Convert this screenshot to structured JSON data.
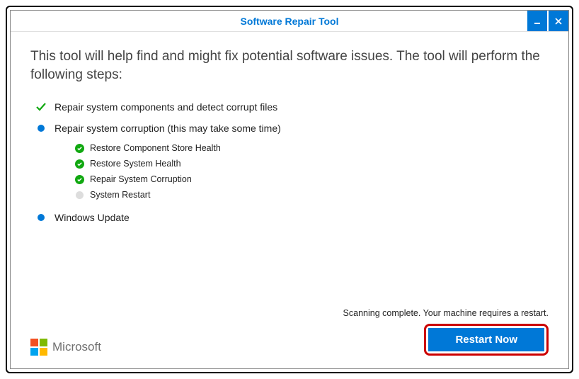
{
  "window": {
    "title": "Software Repair Tool"
  },
  "intro": "This tool will help find and might fix potential software issues. The tool will perform the following steps:",
  "steps": [
    {
      "status": "done",
      "label": "Repair system components and detect corrupt files"
    },
    {
      "status": "current",
      "label": "Repair system corruption (this may take some time)",
      "substeps": [
        {
          "status": "done",
          "label": "Restore Component Store Health"
        },
        {
          "status": "done",
          "label": "Restore System Health"
        },
        {
          "status": "done",
          "label": "Repair System Corruption"
        },
        {
          "status": "pending",
          "label": "System Restart"
        }
      ]
    },
    {
      "status": "pending_top",
      "label": "Windows Update"
    }
  ],
  "footer": {
    "brand": "Microsoft",
    "status": "Scanning complete. Your machine requires a restart.",
    "restart_label": "Restart Now"
  }
}
